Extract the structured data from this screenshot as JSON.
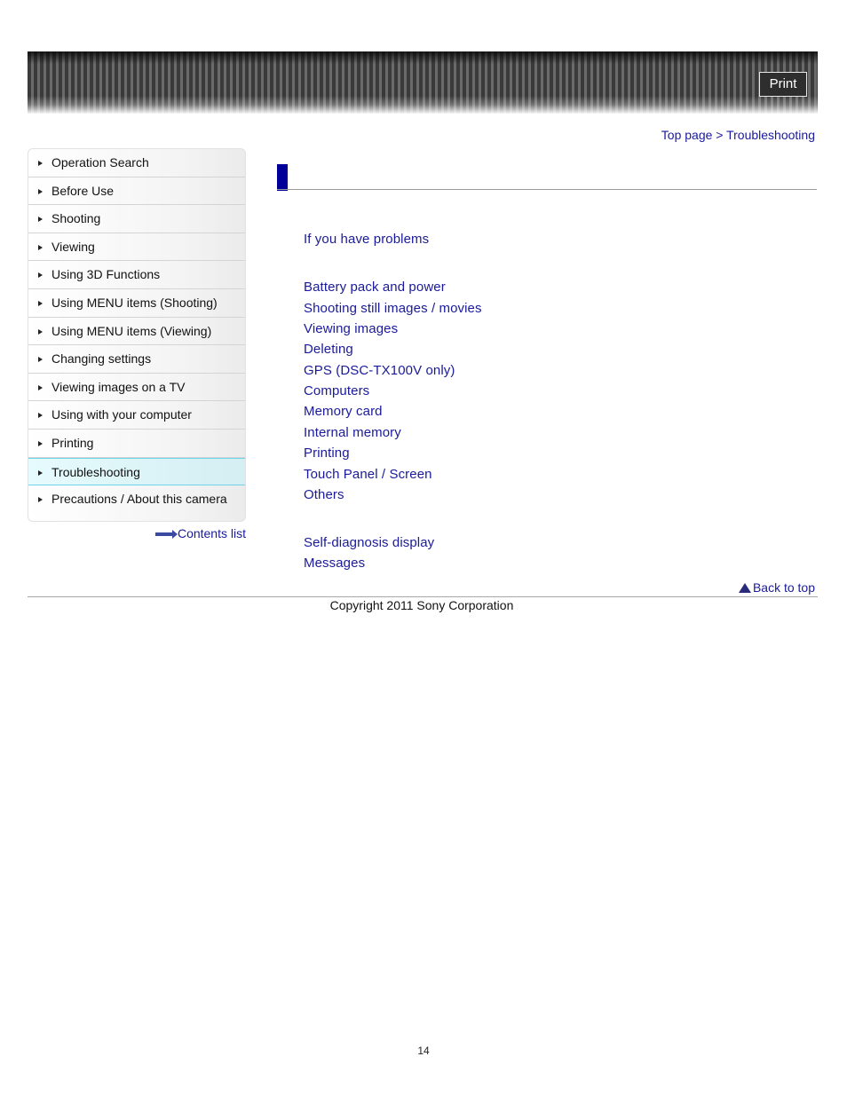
{
  "header": {
    "print_label": "Print"
  },
  "breadcrumb": {
    "top_page": "Top page",
    "separator": " > ",
    "current": "Troubleshooting"
  },
  "sidebar": {
    "items": [
      {
        "label": "Operation Search",
        "active": false
      },
      {
        "label": "Before Use",
        "active": false
      },
      {
        "label": "Shooting",
        "active": false
      },
      {
        "label": "Viewing",
        "active": false
      },
      {
        "label": "Using 3D Functions",
        "active": false
      },
      {
        "label": "Using MENU items (Shooting)",
        "active": false
      },
      {
        "label": "Using MENU items (Viewing)",
        "active": false
      },
      {
        "label": "Changing settings",
        "active": false
      },
      {
        "label": "Viewing images on a TV",
        "active": false
      },
      {
        "label": "Using with your computer",
        "active": false
      },
      {
        "label": "Printing",
        "active": false
      },
      {
        "label": "Troubleshooting",
        "active": true
      },
      {
        "label": "Precautions / About this camera",
        "active": false
      }
    ],
    "contents_list": "Contents list"
  },
  "main": {
    "intro_link": "If you have problems",
    "topic_links": [
      "Battery pack and power",
      "Shooting still images / movies",
      "Viewing images",
      "Deleting",
      "GPS (DSC-TX100V only)",
      "Computers",
      "Memory card",
      "Internal memory",
      "Printing",
      "Touch Panel / Screen",
      "Others"
    ],
    "message_links": [
      "Self-diagnosis display",
      "Messages"
    ]
  },
  "footer": {
    "back_to_top": "Back to top",
    "copyright": "Copyright 2011 Sony Corporation",
    "page_number": "14"
  },
  "colors": {
    "link": "#1a1a9a",
    "title_mark": "#000099",
    "active_item": "#e6fbfd"
  }
}
